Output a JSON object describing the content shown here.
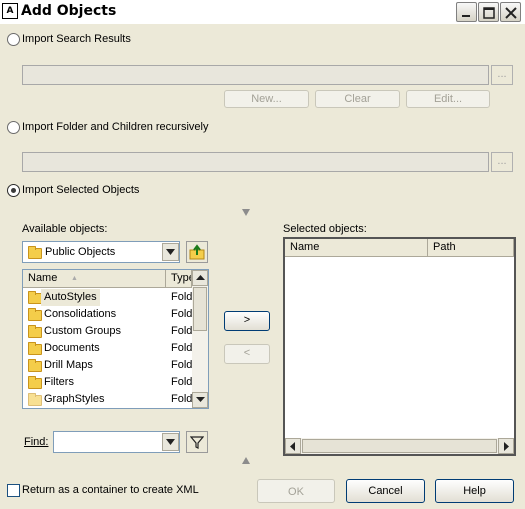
{
  "window": {
    "title": "Add Objects"
  },
  "import_search": {
    "label": "Import Search Results",
    "path_value": "",
    "browse_label": "...",
    "new_label": "New...",
    "clear_label": "Clear",
    "edit_label": "Edit..."
  },
  "import_folder": {
    "label": "Import Folder and Children recursively",
    "path_value": "",
    "browse_label": "..."
  },
  "import_selected": {
    "label": "Import Selected Objects",
    "selected": true
  },
  "available": {
    "label": "Available objects:",
    "folder_value": "Public Objects",
    "columns": [
      "Name",
      "Type"
    ],
    "sort_indicator": "▲",
    "rows": [
      {
        "name": "AutoStyles",
        "type": "Fold"
      },
      {
        "name": "Consolidations",
        "type": "Fold"
      },
      {
        "name": "Custom Groups",
        "type": "Fold"
      },
      {
        "name": "Documents",
        "type": "Fold"
      },
      {
        "name": "Drill Maps",
        "type": "Fold"
      },
      {
        "name": "Filters",
        "type": "Fold"
      },
      {
        "name": "GraphStyles",
        "type": "Fold"
      }
    ]
  },
  "find": {
    "label": "Find:",
    "value": ""
  },
  "move_right_label": ">",
  "move_left_label": "<",
  "selected": {
    "label": "Selected objects:",
    "columns": [
      "Name",
      "Path"
    ]
  },
  "footer": {
    "xml_checkbox_label": "Return as a container to create XML",
    "ok_label": "OK",
    "cancel_label": "Cancel",
    "help_label": "Help"
  }
}
